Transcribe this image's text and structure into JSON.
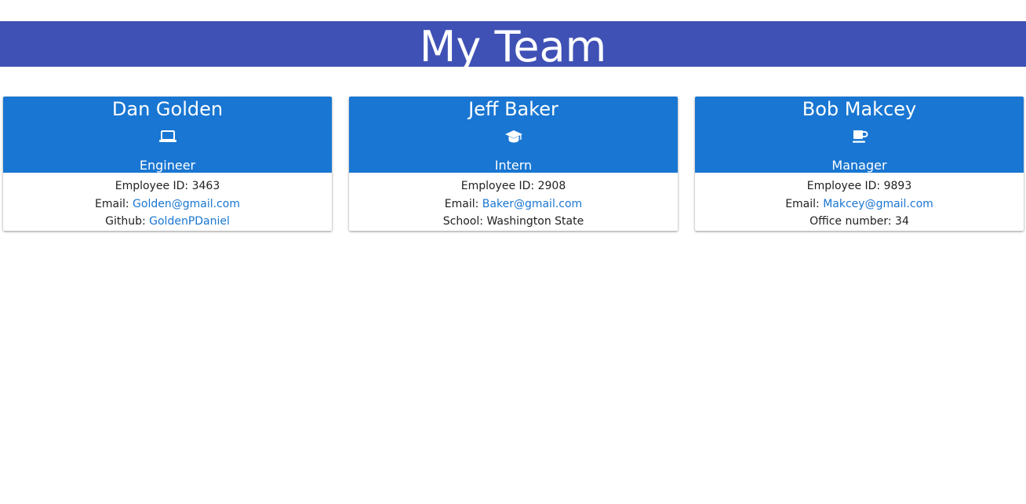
{
  "page": {
    "title": "My Team",
    "header_color": "#3f51b5",
    "card_header_color": "#1976d2",
    "link_color": "#1976d2"
  },
  "team": [
    {
      "name": "Dan Golden",
      "icon": "laptop-icon",
      "role": "Engineer",
      "id_label": "Employee ID:",
      "id_value": "3463",
      "email_label": "Email:",
      "email": "Golden@gmail.com",
      "extra_label": "Github:",
      "extra_value": "GoldenPDaniel"
    },
    {
      "name": "Jeff Baker",
      "icon": "graduation-cap-icon",
      "role": "Intern",
      "id_label": "Employee ID:",
      "id_value": "2908",
      "email_label": "Email:",
      "email": "Baker@gmail.com",
      "extra_label": "School:",
      "extra_value": "Washington State"
    },
    {
      "name": "Bob Makcey",
      "icon": "coffee-mug-icon",
      "role": "Manager",
      "id_label": "Employee ID:",
      "id_value": "9893",
      "email_label": "Email:",
      "email": "Makcey@gmail.com",
      "extra_label": "Office number:",
      "extra_value": "34"
    }
  ]
}
